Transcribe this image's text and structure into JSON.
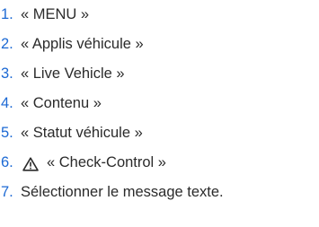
{
  "colors": {
    "accent": "#1c69d4",
    "text": "#2b2b2b"
  },
  "steps": [
    {
      "num": "1.",
      "text": "« MENU »"
    },
    {
      "num": "2.",
      "text": "« Applis véhicule »"
    },
    {
      "num": "3.",
      "text": "« Live Vehicle »"
    },
    {
      "num": "4.",
      "text": "« Contenu »"
    },
    {
      "num": "5.",
      "text": "« Statut véhicule »"
    },
    {
      "num": "6.",
      "icon": "warning-triangle-icon",
      "text": "« Check-Control »"
    },
    {
      "num": "7.",
      "text": "Sélectionner le message texte."
    }
  ]
}
